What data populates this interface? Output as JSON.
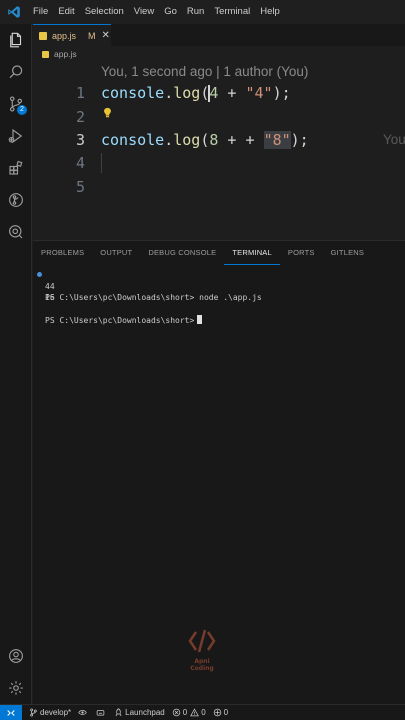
{
  "menu": [
    "File",
    "Edit",
    "Selection",
    "View",
    "Go",
    "Run",
    "Terminal",
    "Help"
  ],
  "tab": {
    "filename": "app.js",
    "modified": "M",
    "close": "✕"
  },
  "breadcrumb": "app.js",
  "activity_badge": "2",
  "editor": {
    "blame": "You, 1 second ago | 1 author (You)",
    "ghost_blame": "You",
    "line_numbers": [
      "1",
      "2",
      "3",
      "4",
      "5"
    ],
    "line1": {
      "fn_obj": "console",
      "dot": ".",
      "fn": "log",
      "open": "(",
      "num": "4",
      "op": " + ",
      "str": "\"4\"",
      "close": ");"
    },
    "line3": {
      "fn_obj": "console",
      "dot": ".",
      "fn": "log",
      "open": "(",
      "num": "8",
      "op": " + + ",
      "str": "\"8\"",
      "close": ");"
    }
  },
  "panel": {
    "tabs": [
      "PROBLEMS",
      "OUTPUT",
      "DEBUG CONSOLE",
      "TERMINAL",
      "PORTS",
      "GITLENS"
    ],
    "active_tab": "TERMINAL",
    "terminal": {
      "line1": "PS C:\\Users\\pc\\Downloads\\short> node .\\app.js",
      "out1": "44",
      "out2": "16",
      "prompt": "PS C:\\Users\\pc\\Downloads\\short>"
    }
  },
  "watermark": {
    "line1": "Apni",
    "line2": "Coding"
  },
  "statusbar": {
    "branch": "develop*",
    "launchpad": "Launchpad",
    "errors": "0",
    "warnings": "0",
    "ports": "0"
  },
  "colors": {
    "accent": "#0078d4",
    "string": "#ce9178",
    "function": "#dcdcaa",
    "number": "#b5cea8",
    "variable": "#9cdcfe",
    "modified": "#e2c08d"
  }
}
